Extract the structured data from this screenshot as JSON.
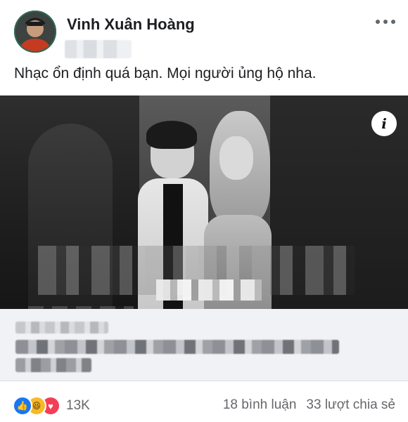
{
  "post": {
    "author": "Vinh Xuân Hoàng",
    "caption": "Nhạc ổn định quá bạn. Mọi người ủng hộ nha.",
    "more_icon": "more-horizontal-icon",
    "info_icon": "info-icon",
    "info_label": "i"
  },
  "reactions": {
    "icons": [
      "like-icon",
      "haha-icon",
      "love-icon"
    ],
    "like_glyph": "👍",
    "haha_glyph": "😆",
    "love_glyph": "♥",
    "count": "13K"
  },
  "stats": {
    "comments": "18 bình luận",
    "shares": "33 lượt chia sẻ"
  },
  "colors": {
    "like": "#1877f2",
    "haha": "#f7b928",
    "love": "#f33e58",
    "secondary_text": "#65676b"
  }
}
